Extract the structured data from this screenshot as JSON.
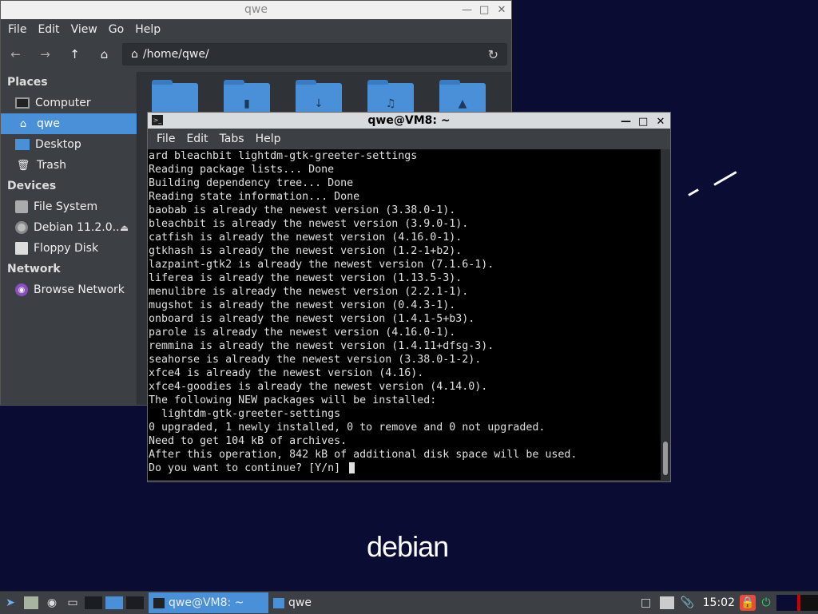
{
  "desktop": {
    "logo_text": "debian"
  },
  "file_manager": {
    "title": "qwe",
    "menu": [
      "File",
      "Edit",
      "View",
      "Go",
      "Help"
    ],
    "path": "/home/qwe/",
    "sidebar": {
      "places_header": "Places",
      "places": [
        {
          "label": "Computer",
          "icon": "computer-icon"
        },
        {
          "label": "qwe",
          "icon": "home-icon",
          "active": true
        },
        {
          "label": "Desktop",
          "icon": "desktop-icon"
        },
        {
          "label": "Trash",
          "icon": "trash-icon"
        }
      ],
      "devices_header": "Devices",
      "devices": [
        {
          "label": "File System",
          "icon": "drive-icon"
        },
        {
          "label": "Debian 11.2.0...",
          "icon": "cdrom-icon",
          "eject": true
        },
        {
          "label": "Floppy Disk",
          "icon": "floppy-icon"
        }
      ],
      "network_header": "Network",
      "network": [
        {
          "label": "Browse Network",
          "icon": "network-icon"
        }
      ]
    }
  },
  "terminal": {
    "title": "qwe@VM8: ~",
    "menu": [
      "File",
      "Edit",
      "Tabs",
      "Help"
    ],
    "lines": [
      "ard bleachbit lightdm-gtk-greeter-settings",
      "Reading package lists... Done",
      "Building dependency tree... Done",
      "Reading state information... Done",
      "baobab is already the newest version (3.38.0-1).",
      "bleachbit is already the newest version (3.9.0-1).",
      "catfish is already the newest version (4.16.0-1).",
      "gtkhash is already the newest version (1.2-1+b2).",
      "lazpaint-gtk2 is already the newest version (7.1.6-1).",
      "liferea is already the newest version (1.13.5-3).",
      "menulibre is already the newest version (2.2.1-1).",
      "mugshot is already the newest version (0.4.3-1).",
      "onboard is already the newest version (1.4.1-5+b3).",
      "parole is already the newest version (4.16.0-1).",
      "remmina is already the newest version (1.4.11+dfsg-3).",
      "seahorse is already the newest version (3.38.0-1-2).",
      "xfce4 is already the newest version (4.16).",
      "xfce4-goodies is already the newest version (4.14.0).",
      "The following NEW packages will be installed:",
      "  lightdm-gtk-greeter-settings",
      "0 upgraded, 1 newly installed, 0 to remove and 0 not upgraded.",
      "Need to get 104 kB of archives.",
      "After this operation, 842 kB of additional disk space will be used.",
      "Do you want to continue? [Y/n] "
    ]
  },
  "taskbar": {
    "tasks": [
      {
        "label": "qwe@VM8: ~",
        "active": true
      },
      {
        "label": "qwe",
        "active": false
      }
    ],
    "clock": "15:02"
  }
}
